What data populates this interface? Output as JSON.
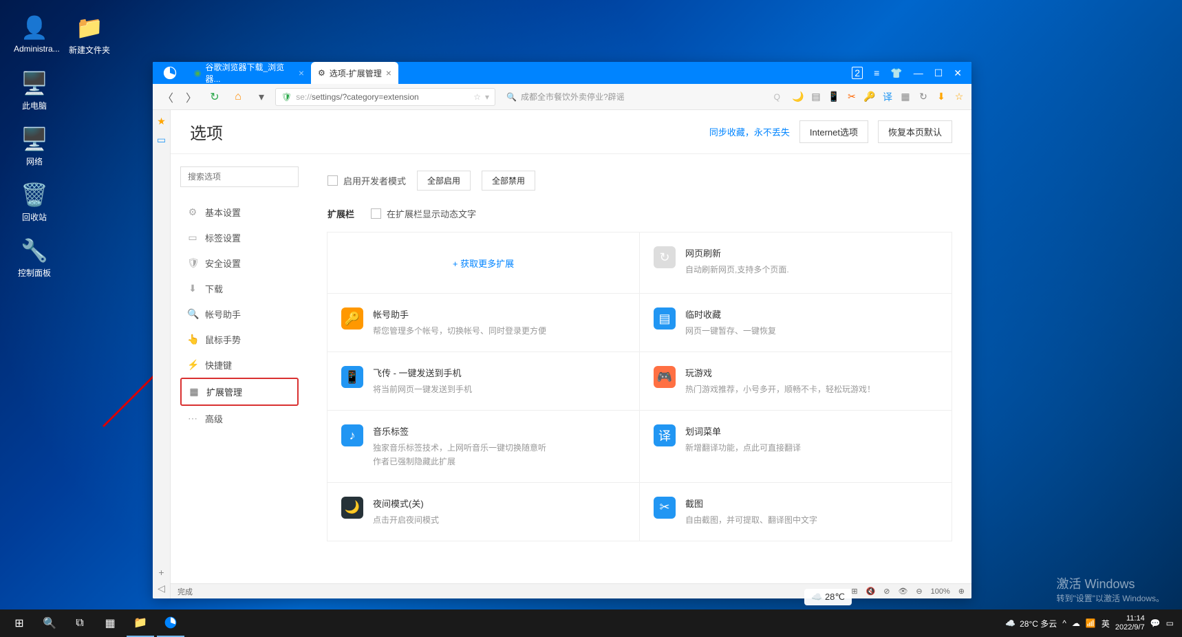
{
  "desktop": {
    "admin": "Administra...",
    "folder": "新建文件夹",
    "pc": "此电脑",
    "network": "网络",
    "recycle": "回收站",
    "control": "控制面板"
  },
  "tabs": {
    "t1": "谷歌浏览器下载_浏览器...",
    "t2": "选项-扩展管理"
  },
  "url": {
    "prefix": "se://",
    "rest": "settings/?category=extension"
  },
  "searchHint": "成都全市餐饮外卖停业?辟谣",
  "header": {
    "title": "选项",
    "sync": "同步收藏，永不丢失",
    "internet": "Internet选项",
    "restore": "恢复本页默认"
  },
  "sidebar": {
    "placeholder": "搜索选项",
    "items": [
      {
        "icon": "⚙",
        "label": "基本设置"
      },
      {
        "icon": "▭",
        "label": "标签设置"
      },
      {
        "icon": "🛡",
        "label": "安全设置"
      },
      {
        "icon": "⬇",
        "label": "下载"
      },
      {
        "icon": "🔍",
        "label": "帐号助手"
      },
      {
        "icon": "👆",
        "label": "鼠标手势"
      },
      {
        "icon": "⚡",
        "label": "快捷键"
      },
      {
        "icon": "▦",
        "label": "扩展管理"
      },
      {
        "icon": "⋯",
        "label": "高级"
      }
    ]
  },
  "top": {
    "devMode": "启用开发者模式",
    "enableAll": "全部启用",
    "disableAll": "全部禁用",
    "extBar": "扩展栏",
    "showText": "在扩展栏显示动态文字"
  },
  "getMore": "+ 获取更多扩展",
  "extensions": [
    {
      "title": "网页刷新",
      "desc": "自动刷新网页,支持多个页面.",
      "bg": "#ddd",
      "icon": "↻"
    },
    {
      "title": "帐号助手",
      "desc": "帮您管理多个帐号，切换帐号、同时登录更方便",
      "bg": "#ff9800",
      "icon": "🔑"
    },
    {
      "title": "临时收藏",
      "desc": "网页一键暂存、一键恢复",
      "bg": "#2196f3",
      "icon": "▤"
    },
    {
      "title": "飞传 - 一键发送到手机",
      "desc": "将当前网页一键发送到手机",
      "bg": "#2196f3",
      "icon": "📱"
    },
    {
      "title": "玩游戏",
      "desc": "热门游戏推荐，小号多开，顺畅不卡，轻松玩游戏！",
      "bg": "#ff7043",
      "icon": "🎮"
    },
    {
      "title": "音乐标签",
      "desc": "独家音乐标签技术，上网听音乐一键切换随意听\n作者已强制隐藏此扩展",
      "bg": "#2196f3",
      "icon": "♪"
    },
    {
      "title": "划词菜单",
      "desc": "新增翻译功能，点此可直接翻译",
      "bg": "#2196f3",
      "icon": "译"
    },
    {
      "title": "夜间模式(关)",
      "desc": "点击开启夜间模式",
      "bg": "#263238",
      "icon": "🌙"
    },
    {
      "title": "截图",
      "desc": "自由截图，并可提取、翻译图中文字",
      "bg": "#2196f3",
      "icon": "✂"
    }
  ],
  "status": {
    "done": "完成",
    "zoom": "100%"
  },
  "taskbar": {
    "weather": "28°C 多云",
    "ime": "英",
    "time": "11:14",
    "date": "2022/9/7"
  },
  "watermark": {
    "l1": "激活 Windows",
    "l2": "转到\"设置\"以激活 Windows。"
  },
  "widget": "28℃"
}
